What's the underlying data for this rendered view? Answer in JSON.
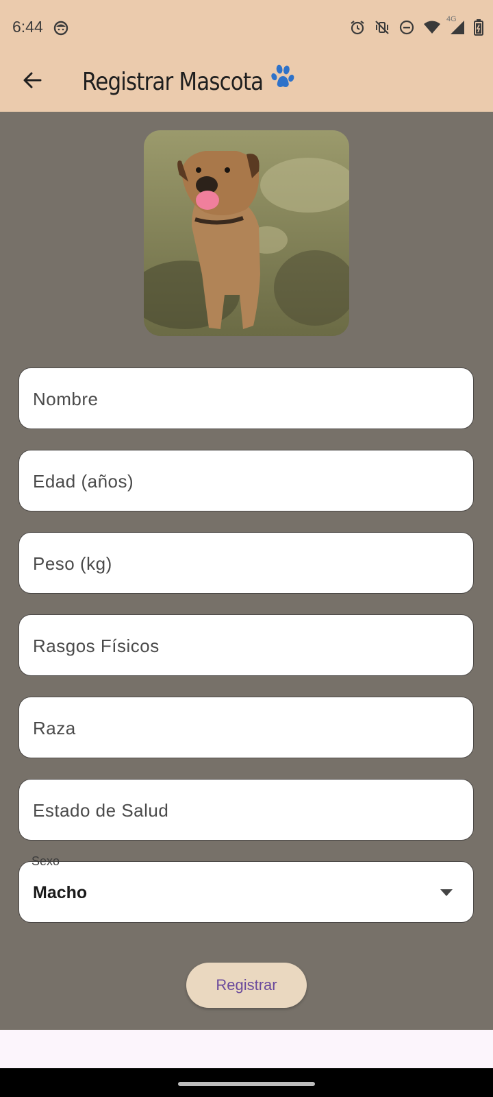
{
  "status_bar": {
    "time": "6:44",
    "network_label": "4G",
    "icons": [
      "face-icon",
      "alarm-icon",
      "vibrate-off-icon",
      "do-not-disturb-icon",
      "wifi-icon",
      "signal-icon",
      "battery-icon"
    ]
  },
  "app_bar": {
    "title": "Registrar Mascota",
    "back_icon": "arrow-back-icon",
    "title_icon": "paw-icon",
    "background": "#ebcbad"
  },
  "form": {
    "photo": {
      "subject": "dog"
    },
    "fields": [
      {
        "id": "nombre",
        "placeholder": "Nombre"
      },
      {
        "id": "edad",
        "placeholder": "Edad (años)"
      },
      {
        "id": "peso",
        "placeholder": "Peso (kg)"
      },
      {
        "id": "rasgos",
        "placeholder": "Rasgos Físicos"
      },
      {
        "id": "raza",
        "placeholder": "Raza"
      },
      {
        "id": "salud",
        "placeholder": "Estado de Salud"
      }
    ],
    "sexo": {
      "label": "Sexo",
      "value": "Macho"
    },
    "submit_label": "Registrar",
    "background": "#777169"
  },
  "colors": {
    "accent_text": "#6a4a9c",
    "button_bg": "#ead8c0"
  }
}
